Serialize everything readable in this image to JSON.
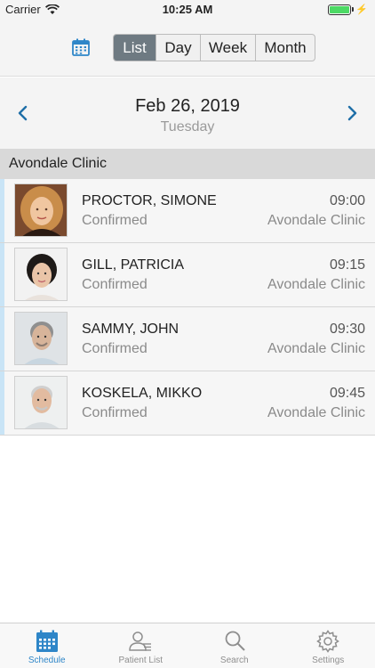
{
  "status_bar": {
    "carrier": "Carrier",
    "time": "10:25 AM",
    "battery_level": 1.0
  },
  "toolbar": {
    "calendar_icon": "calendar-icon",
    "segments": [
      {
        "label": "List",
        "active": true
      },
      {
        "label": "Day",
        "active": false
      },
      {
        "label": "Week",
        "active": false
      },
      {
        "label": "Month",
        "active": false
      }
    ]
  },
  "date_nav": {
    "date": "Feb 26, 2019",
    "weekday": "Tuesday",
    "prev_icon": "chevron-left-icon",
    "next_icon": "chevron-right-icon"
  },
  "section": {
    "title": "Avondale Clinic"
  },
  "appointments": [
    {
      "name": "PROCTOR, SIMONE",
      "status": "Confirmed",
      "time": "09:00",
      "location": "Avondale Clinic"
    },
    {
      "name": "GILL, PATRICIA",
      "status": "Confirmed",
      "time": "09:15",
      "location": "Avondale Clinic"
    },
    {
      "name": "SAMMY, JOHN",
      "status": "Confirmed",
      "time": "09:30",
      "location": "Avondale Clinic"
    },
    {
      "name": "KOSKELA, MIKKO",
      "status": "Confirmed",
      "time": "09:45",
      "location": "Avondale Clinic"
    }
  ],
  "tab_bar": {
    "tabs": [
      {
        "label": "Schedule",
        "icon": "calendar-icon",
        "active": true
      },
      {
        "label": "Patient List",
        "icon": "patient-list-icon",
        "active": false
      },
      {
        "label": "Search",
        "icon": "search-icon",
        "active": false
      },
      {
        "label": "Settings",
        "icon": "gear-icon",
        "active": false
      }
    ]
  },
  "colors": {
    "accent": "#2e86c8",
    "segment_active": "#6e7a82",
    "row_indicator": "#c9e4f6"
  }
}
